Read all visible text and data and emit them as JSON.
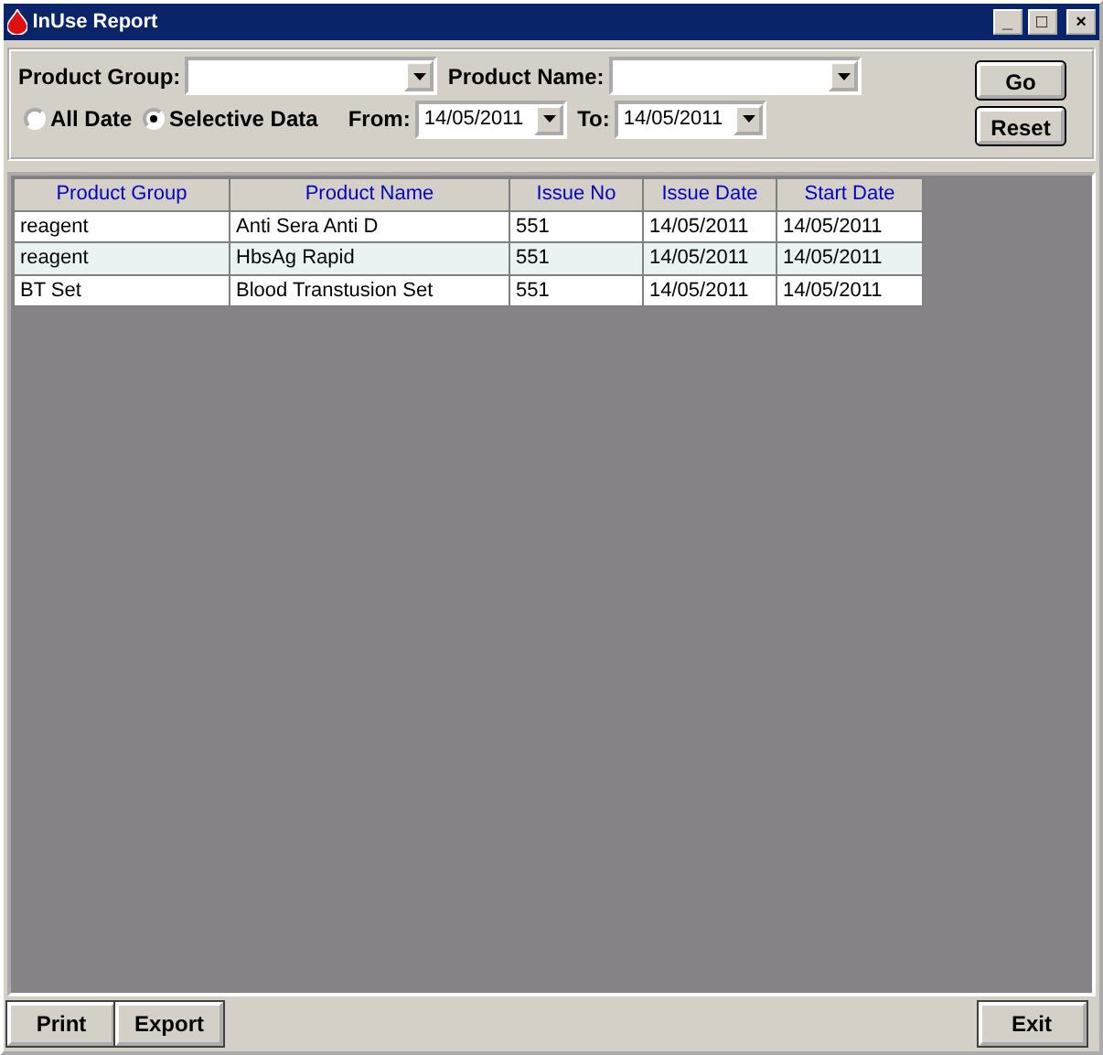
{
  "window": {
    "title": "InUse Report",
    "controls": [
      "_",
      "□",
      "×"
    ]
  },
  "filters": {
    "product_group": {
      "label": "Product Group:"
    },
    "product_name": {
      "label": "Product Name:"
    },
    "date_options": [
      {
        "label": "All Date",
        "selected": false
      },
      {
        "label": "Selective Data",
        "selected": true
      }
    ],
    "from": {
      "label": "From:",
      "value": "14/05/2011"
    },
    "to": {
      "label": "To:",
      "value": "14/05/2011"
    },
    "buttons": [
      "Go",
      "Reset"
    ]
  },
  "table": {
    "columns": [
      "Product Group",
      "Product Name",
      "Issue No",
      "Issue Date",
      "Start Date"
    ],
    "rows": [
      [
        "reagent",
        "Anti Sera Anti D",
        "551",
        "14/05/2011",
        "14/05/2011"
      ],
      [
        "reagent",
        "HbsAg Rapid",
        "551",
        "14/05/2011",
        "14/05/2011"
      ],
      [
        "BT Set",
        "Blood Transtusion Set",
        "551",
        "14/05/2011",
        "14/05/2011"
      ]
    ]
  },
  "footer_buttons": {
    "left": [
      "Print",
      "Export"
    ],
    "right": [
      "Exit"
    ]
  }
}
